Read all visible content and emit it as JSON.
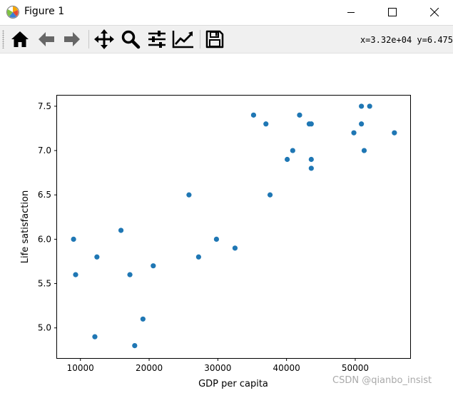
{
  "window": {
    "title": "Figure 1",
    "icon": "matplotlib-logo-icon",
    "controls": [
      "minimize-icon",
      "maximize-icon",
      "close-icon"
    ]
  },
  "toolbar": {
    "buttons": [
      "home-icon",
      "back-arrow-icon",
      "forward-arrow-icon",
      "pan-move-icon",
      "zoom-magnifier-icon",
      "configure-subplots-icon",
      "edit-axes-icon",
      "save-disk-icon"
    ],
    "coordinates": "x=3.32e+04 y=6.475"
  },
  "chart_data": {
    "type": "scatter",
    "xlabel": "GDP per capita",
    "ylabel": "Life satisfaction",
    "xlim": [
      6600,
      58000
    ],
    "ylim": [
      4.66,
      7.62
    ],
    "x_ticks": [
      10000,
      20000,
      30000,
      40000,
      50000
    ],
    "x_tick_labels": [
      "10000",
      "20000",
      "30000",
      "40000",
      "50000"
    ],
    "y_ticks": [
      5.0,
      5.5,
      6.0,
      6.5,
      7.0,
      7.5
    ],
    "y_tick_labels": [
      "5.0",
      "5.5",
      "6.0",
      "6.5",
      "7.0",
      "7.5"
    ],
    "grid": false,
    "color": "#1f77b4",
    "points": [
      {
        "x": 9000,
        "y": 6.0
      },
      {
        "x": 9300,
        "y": 5.6
      },
      {
        "x": 12100,
        "y": 4.9
      },
      {
        "x": 12400,
        "y": 5.8
      },
      {
        "x": 15900,
        "y": 6.1
      },
      {
        "x": 17200,
        "y": 5.6
      },
      {
        "x": 17900,
        "y": 4.8
      },
      {
        "x": 19100,
        "y": 5.1
      },
      {
        "x": 20600,
        "y": 5.7
      },
      {
        "x": 25800,
        "y": 6.5
      },
      {
        "x": 27200,
        "y": 5.8
      },
      {
        "x": 29800,
        "y": 6.0
      },
      {
        "x": 32500,
        "y": 5.9
      },
      {
        "x": 35200,
        "y": 7.4
      },
      {
        "x": 37000,
        "y": 7.3
      },
      {
        "x": 37600,
        "y": 6.5
      },
      {
        "x": 40100,
        "y": 6.9
      },
      {
        "x": 40900,
        "y": 7.0
      },
      {
        "x": 41900,
        "y": 7.4
      },
      {
        "x": 43300,
        "y": 7.3
      },
      {
        "x": 43600,
        "y": 7.3
      },
      {
        "x": 43600,
        "y": 6.9
      },
      {
        "x": 43600,
        "y": 6.8
      },
      {
        "x": 49800,
        "y": 7.2
      },
      {
        "x": 50900,
        "y": 7.5
      },
      {
        "x": 50900,
        "y": 7.3
      },
      {
        "x": 51300,
        "y": 7.0
      },
      {
        "x": 52100,
        "y": 7.5
      },
      {
        "x": 55700,
        "y": 7.2
      }
    ]
  },
  "watermark": "CSDN @qianbo_insist"
}
